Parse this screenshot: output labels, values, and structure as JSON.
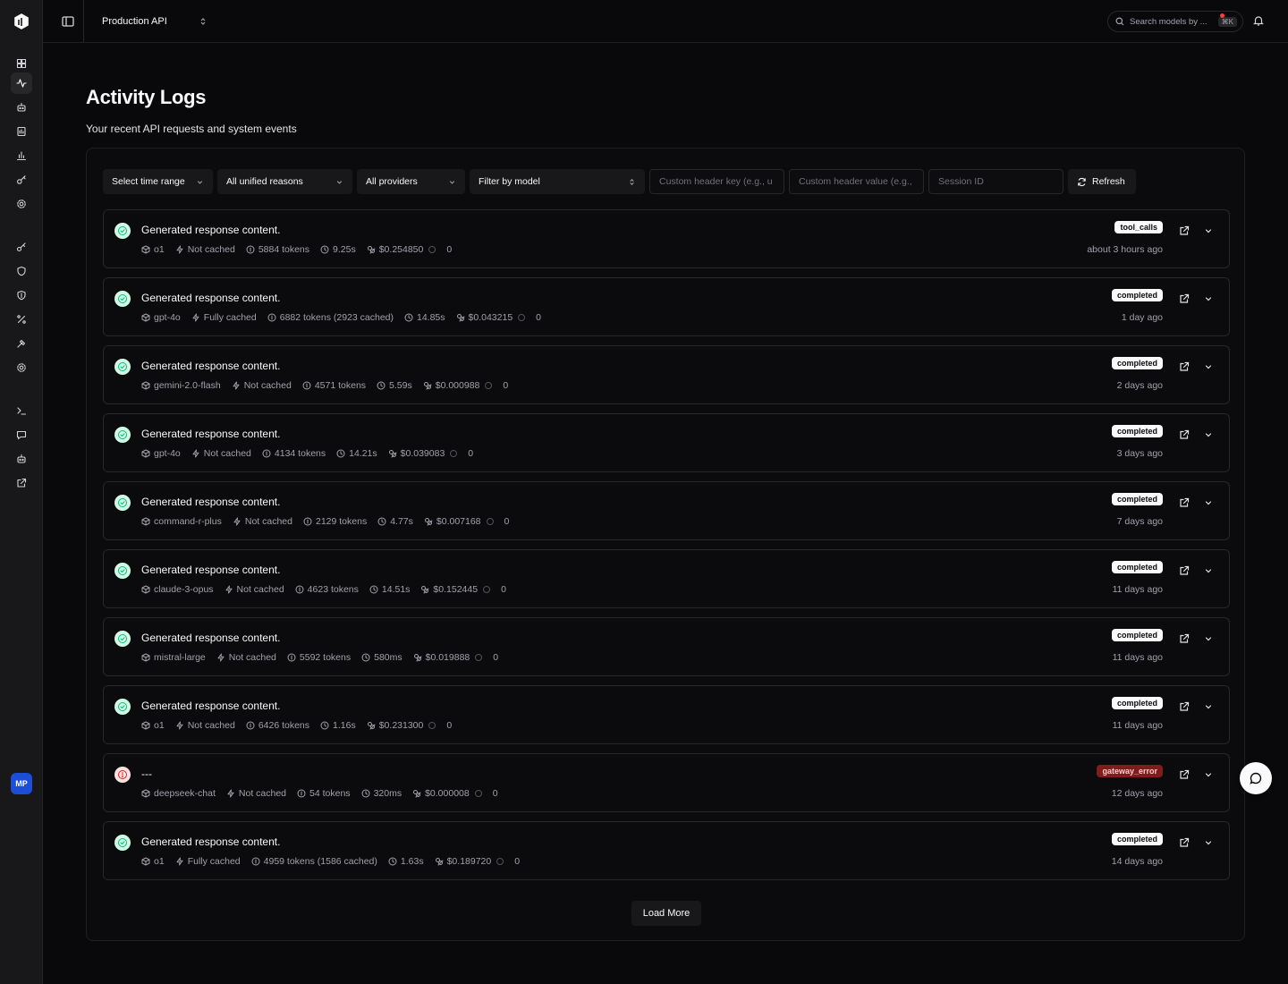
{
  "topbar": {
    "project": "Production API",
    "search_placeholder": "Search models by ...",
    "search_shortcut": "⌘K"
  },
  "sidebar": {
    "items": [
      {
        "name": "dashboard-icon",
        "active": false
      },
      {
        "name": "activity-icon",
        "active": true
      },
      {
        "name": "bot-icon",
        "active": false
      },
      {
        "name": "report-icon",
        "active": false
      },
      {
        "name": "bar-chart-icon",
        "active": false
      },
      {
        "name": "key-icon",
        "active": false
      },
      {
        "name": "settings-icon",
        "active": false
      },
      {
        "name": "key-alt-icon",
        "active": false
      },
      {
        "name": "shield-icon",
        "active": false
      },
      {
        "name": "shield-alert-icon",
        "active": false
      },
      {
        "name": "percent-icon",
        "active": false
      },
      {
        "name": "hammer-icon",
        "active": false
      },
      {
        "name": "gear-icon",
        "active": false
      },
      {
        "name": "terminal-icon",
        "active": false
      },
      {
        "name": "message-icon",
        "active": false
      },
      {
        "name": "bot-alt-icon",
        "active": false
      },
      {
        "name": "external-link-icon",
        "active": false
      }
    ],
    "avatar": "MP"
  },
  "page": {
    "title": "Activity Logs",
    "subtitle": "Your recent API requests and system events"
  },
  "filters": {
    "time_range": "Select time range",
    "reasons": "All unified reasons",
    "providers": "All providers",
    "model": "Filter by model",
    "header_key_placeholder": "Custom header key (e.g., u",
    "header_value_placeholder": "Custom header value (e.g.,",
    "session_placeholder": "Session ID",
    "refresh": "Refresh"
  },
  "logs": [
    {
      "status": "ok",
      "title": "Generated response content.",
      "model": "o1",
      "cache": "Not cached",
      "tokens": "5884 tokens",
      "duration": "9.25s",
      "cost": "$0.254850",
      "count": "0",
      "badge": "tool_calls",
      "badge_type": "normal",
      "time": "about 3 hours ago"
    },
    {
      "status": "ok",
      "title": "Generated response content.",
      "model": "gpt-4o",
      "cache": "Fully cached",
      "tokens": "6882 tokens (2923 cached)",
      "duration": "14.85s",
      "cost": "$0.043215",
      "count": "0",
      "badge": "completed",
      "badge_type": "normal",
      "time": "1 day ago"
    },
    {
      "status": "ok",
      "title": "Generated response content.",
      "model": "gemini-2.0-flash",
      "cache": "Not cached",
      "tokens": "4571 tokens",
      "duration": "5.59s",
      "cost": "$0.000988",
      "count": "0",
      "badge": "completed",
      "badge_type": "normal",
      "time": "2 days ago"
    },
    {
      "status": "ok",
      "title": "Generated response content.",
      "model": "gpt-4o",
      "cache": "Not cached",
      "tokens": "4134 tokens",
      "duration": "14.21s",
      "cost": "$0.039083",
      "count": "0",
      "badge": "completed",
      "badge_type": "normal",
      "time": "3 days ago"
    },
    {
      "status": "ok",
      "title": "Generated response content.",
      "model": "command-r-plus",
      "cache": "Not cached",
      "tokens": "2129 tokens",
      "duration": "4.77s",
      "cost": "$0.007168",
      "count": "0",
      "badge": "completed",
      "badge_type": "normal",
      "time": "7 days ago"
    },
    {
      "status": "ok",
      "title": "Generated response content.",
      "model": "claude-3-opus",
      "cache": "Not cached",
      "tokens": "4623 tokens",
      "duration": "14.51s",
      "cost": "$0.152445",
      "count": "0",
      "badge": "completed",
      "badge_type": "normal",
      "time": "11 days ago"
    },
    {
      "status": "ok",
      "title": "Generated response content.",
      "model": "mistral-large",
      "cache": "Not cached",
      "tokens": "5592 tokens",
      "duration": "580ms",
      "cost": "$0.019888",
      "count": "0",
      "badge": "completed",
      "badge_type": "normal",
      "time": "11 days ago"
    },
    {
      "status": "ok",
      "title": "Generated response content.",
      "model": "o1",
      "cache": "Not cached",
      "tokens": "6426 tokens",
      "duration": "1.16s",
      "cost": "$0.231300",
      "count": "0",
      "badge": "completed",
      "badge_type": "normal",
      "time": "11 days ago"
    },
    {
      "status": "err",
      "title": "---",
      "model": "deepseek-chat",
      "cache": "Not cached",
      "tokens": "54 tokens",
      "duration": "320ms",
      "cost": "$0.000008",
      "count": "0",
      "badge": "gateway_error",
      "badge_type": "error",
      "time": "12 days ago"
    },
    {
      "status": "ok",
      "title": "Generated response content.",
      "model": "o1",
      "cache": "Fully cached",
      "tokens": "4959 tokens (1586 cached)",
      "duration": "1.63s",
      "cost": "$0.189720",
      "count": "0",
      "badge": "completed",
      "badge_type": "normal",
      "time": "14 days ago"
    }
  ],
  "load_more": "Load More"
}
